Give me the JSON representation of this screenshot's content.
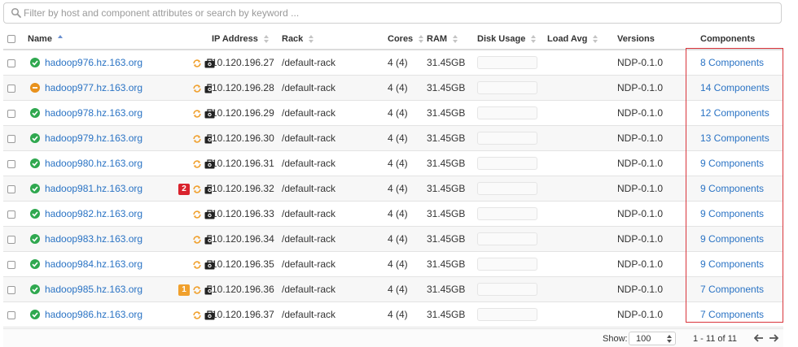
{
  "search": {
    "placeholder": "Filter by host and component attributes or search by keyword ..."
  },
  "table": {
    "headers": {
      "name": "Name",
      "ip": "IP Address",
      "rack": "Rack",
      "cores": "Cores",
      "ram": "RAM",
      "disk": "Disk Usage",
      "load": "Load Avg",
      "versions": "Versions",
      "components": "Components"
    },
    "rows": [
      {
        "host": "hadoop976.hz.163.org",
        "status": "ok",
        "alert": "",
        "ip": "10.120.196.27",
        "rack": "/default-rack",
        "cores": "4 (4)",
        "ram": "31.45GB",
        "version": "NDP-0.1.0",
        "components": "8 Components"
      },
      {
        "host": "hadoop977.hz.163.org",
        "status": "warn",
        "alert": "",
        "ip": "10.120.196.28",
        "rack": "/default-rack",
        "cores": "4 (4)",
        "ram": "31.45GB",
        "version": "NDP-0.1.0",
        "components": "14 Components"
      },
      {
        "host": "hadoop978.hz.163.org",
        "status": "ok",
        "alert": "",
        "ip": "10.120.196.29",
        "rack": "/default-rack",
        "cores": "4 (4)",
        "ram": "31.45GB",
        "version": "NDP-0.1.0",
        "components": "12 Components"
      },
      {
        "host": "hadoop979.hz.163.org",
        "status": "ok",
        "alert": "",
        "ip": "10.120.196.30",
        "rack": "/default-rack",
        "cores": "4 (4)",
        "ram": "31.45GB",
        "version": "NDP-0.1.0",
        "components": "13 Components"
      },
      {
        "host": "hadoop980.hz.163.org",
        "status": "ok",
        "alert": "",
        "ip": "10.120.196.31",
        "rack": "/default-rack",
        "cores": "4 (4)",
        "ram": "31.45GB",
        "version": "NDP-0.1.0",
        "components": "9 Components"
      },
      {
        "host": "hadoop981.hz.163.org",
        "status": "ok",
        "alert": "2",
        "alert_color": "red",
        "ip": "10.120.196.32",
        "rack": "/default-rack",
        "cores": "4 (4)",
        "ram": "31.45GB",
        "version": "NDP-0.1.0",
        "components": "9 Components"
      },
      {
        "host": "hadoop982.hz.163.org",
        "status": "ok",
        "alert": "",
        "ip": "10.120.196.33",
        "rack": "/default-rack",
        "cores": "4 (4)",
        "ram": "31.45GB",
        "version": "NDP-0.1.0",
        "components": "9 Components"
      },
      {
        "host": "hadoop983.hz.163.org",
        "status": "ok",
        "alert": "",
        "ip": "10.120.196.34",
        "rack": "/default-rack",
        "cores": "4 (4)",
        "ram": "31.45GB",
        "version": "NDP-0.1.0",
        "components": "9 Components"
      },
      {
        "host": "hadoop984.hz.163.org",
        "status": "ok",
        "alert": "",
        "ip": "10.120.196.35",
        "rack": "/default-rack",
        "cores": "4 (4)",
        "ram": "31.45GB",
        "version": "NDP-0.1.0",
        "components": "9 Components"
      },
      {
        "host": "hadoop985.hz.163.org",
        "status": "ok",
        "alert": "1",
        "alert_color": "orange",
        "ip": "10.120.196.36",
        "rack": "/default-rack",
        "cores": "4 (4)",
        "ram": "31.45GB",
        "version": "NDP-0.1.0",
        "components": "7 Components"
      },
      {
        "host": "hadoop986.hz.163.org",
        "status": "ok",
        "alert": "",
        "ip": "10.120.196.37",
        "rack": "/default-rack",
        "cores": "4 (4)",
        "ram": "31.45GB",
        "version": "NDP-0.1.0",
        "components": "7 Components"
      }
    ]
  },
  "footer": {
    "show_label": "Show:",
    "page_size": "100",
    "range": "1 - 11 of 11"
  },
  "colors": {
    "link": "#2a73c4",
    "status_ok": "#2fa84f",
    "status_warn": "#e8911c",
    "highlight": "#d9353b"
  },
  "icons": {
    "search": "search-icon",
    "restart": "restart-icon",
    "maintenance": "briefcase-icon",
    "sort": "sort-icon"
  }
}
